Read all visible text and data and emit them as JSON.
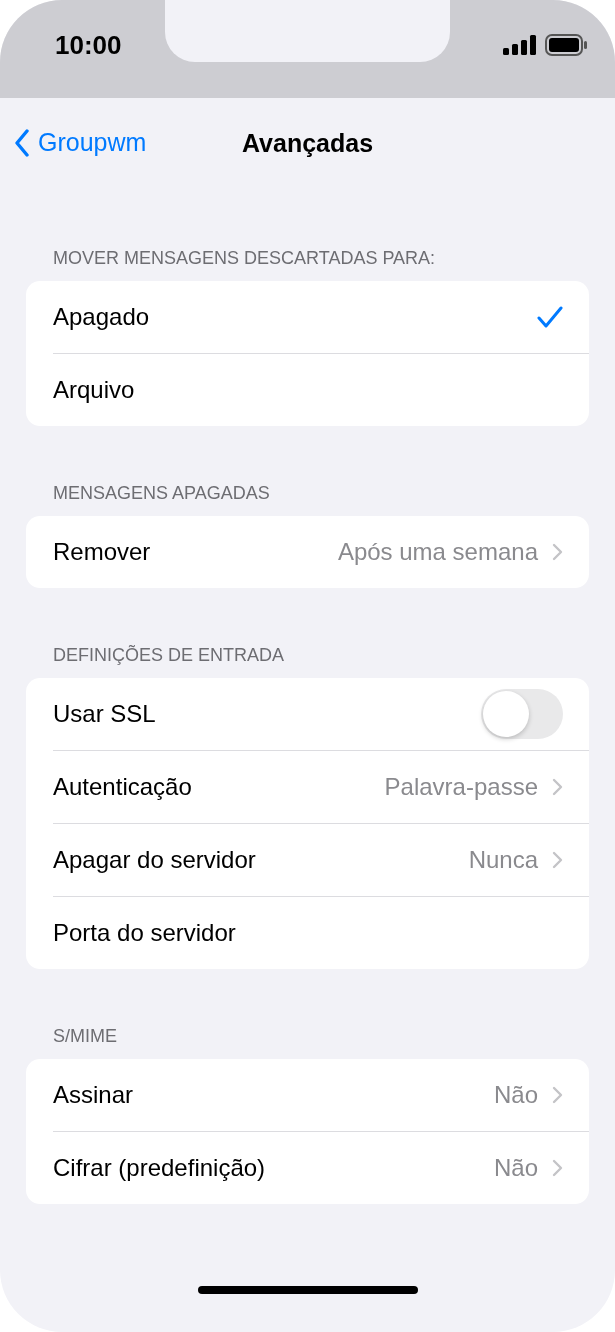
{
  "status_bar": {
    "time": "10:00"
  },
  "nav": {
    "back": "Groupwm",
    "title": "Avançadas"
  },
  "sections": [
    {
      "header": "MOVER MENSAGENS DESCARTADAS PARA:",
      "rows": [
        {
          "kind": "choice",
          "label": "Apagado",
          "selected": true
        },
        {
          "kind": "choice",
          "label": "Arquivo",
          "selected": false
        }
      ]
    },
    {
      "header": "MENSAGENS APAGADAS",
      "rows": [
        {
          "kind": "link",
          "label": "Remover",
          "value": "Após uma semana"
        }
      ]
    },
    {
      "header": "DEFINIÇÕES DE ENTRADA",
      "rows": [
        {
          "kind": "toggle",
          "label": "Usar SSL",
          "on": false
        },
        {
          "kind": "link",
          "label": "Autenticação",
          "value": "Palavra-passe"
        },
        {
          "kind": "link",
          "label": "Apagar do servidor",
          "value": "Nunca"
        },
        {
          "kind": "plain",
          "label": "Porta do servidor"
        }
      ]
    },
    {
      "header": "S/MIME",
      "rows": [
        {
          "kind": "link",
          "label": "Assinar",
          "value": "Não"
        },
        {
          "kind": "link",
          "label": "Cifrar (predefinição)",
          "value": "Não"
        }
      ]
    }
  ]
}
